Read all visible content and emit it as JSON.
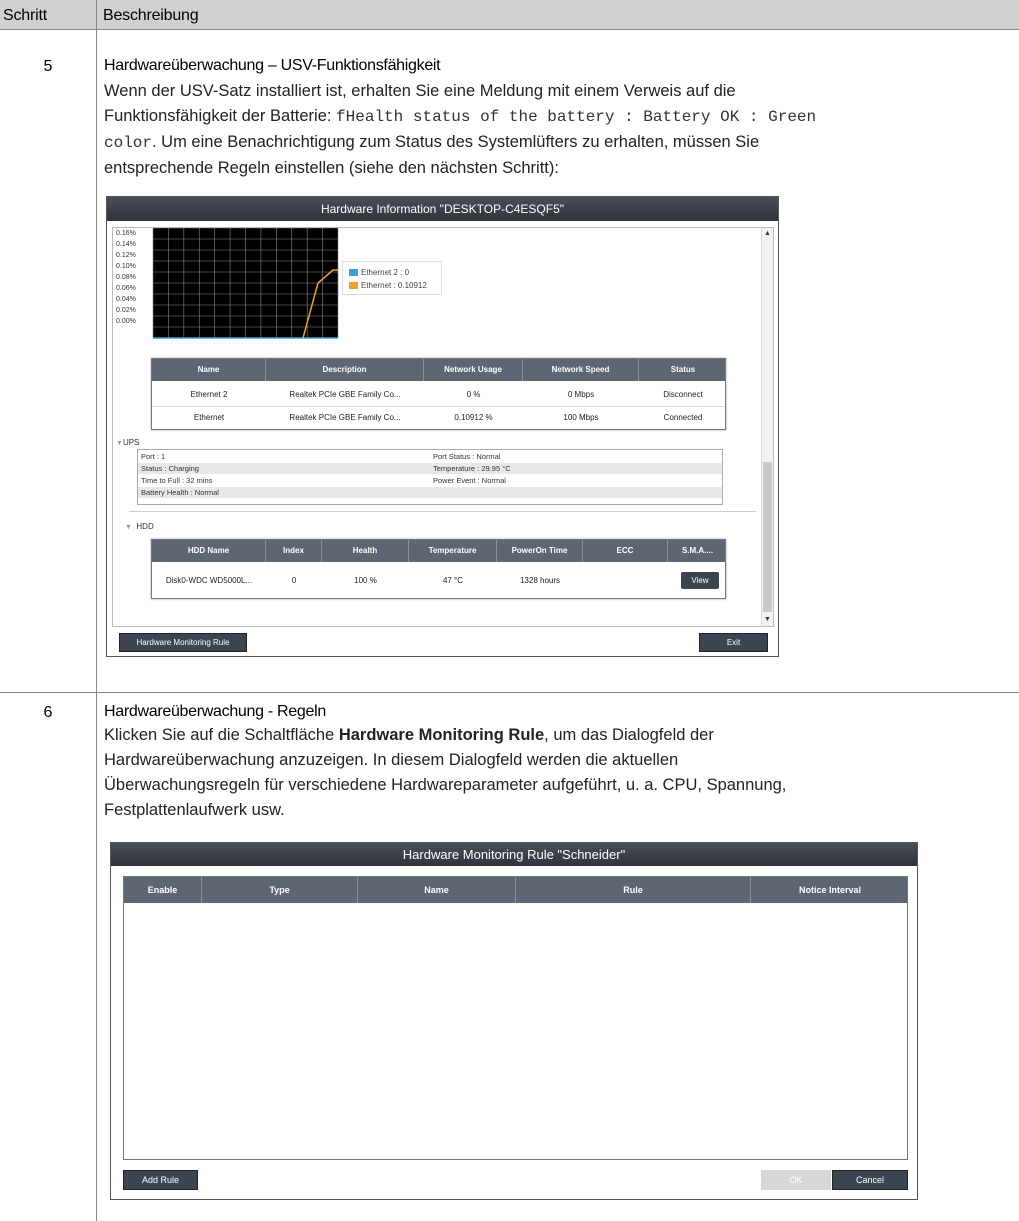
{
  "table": {
    "header_step": "Schritt",
    "header_desc": "Beschreibung"
  },
  "step5": {
    "number": "5",
    "title": "Hardwareüberwachung – USV-Funktionsfähigkeit",
    "body_line1": "Wenn der USV-Satz installiert ist, erhalten Sie eine Meldung mit einem Verweis auf die",
    "body_line2_prefix": "Funktionsfähigkeit der Batterie: ",
    "body_code_1": "fHealth status of the battery : Battery OK : Green",
    "body_code_2": "color",
    "body_line3_suffix": ". Um eine Benachrichtigung zum Status des Systemlüfters zu erhalten, müssen Sie",
    "body_line4": "entsprechende Regeln einstellen (siehe den nächsten Schritt):"
  },
  "win1": {
    "title": "Hardware Information \"DESKTOP-C4ESQF5\"",
    "y_ticks": [
      "0.16%",
      "0.14%",
      "0.12%",
      "0.10%",
      "0.08%",
      "0.06%",
      "0.04%",
      "0.02%",
      "0.00%"
    ],
    "legend": [
      {
        "label": "Ethernet 2 : 0",
        "color": "#3aa0d8"
      },
      {
        "label": "Ethernet : 0.10912",
        "color": "#f0a030"
      }
    ],
    "network_columns": [
      "Name",
      "Description",
      "Network Usage",
      "Network Speed",
      "Status"
    ],
    "network_rows": [
      [
        "Ethernet 2",
        "Realtek PCIe GBE Family Co...",
        "0 %",
        "0 Mbps",
        "Disconnect"
      ],
      [
        "Ethernet",
        "Realtek PCIe GBE Family Co...",
        "0.10912 %",
        "100 Mbps",
        "Connected"
      ]
    ],
    "ups_label": "UPS",
    "ups": {
      "port": "Port : 1",
      "port_status": "Port Status : Normal",
      "status": "Status : Charging",
      "temperature": "Temperature : 29.95 °C",
      "time_to_full": "Time to Full : 32 mins",
      "power_event": "Power Event : Normal",
      "battery_health": "Battery Health : Normal"
    },
    "hdd_label": "HDD",
    "hdd_columns": [
      "HDD Name",
      "Index",
      "Health",
      "Temperature",
      "PowerOn Time",
      "ECC",
      "S.M.A...."
    ],
    "hdd_row": [
      "Disk0-WDC WD5000L...",
      "0",
      "100 %",
      "47 °C",
      "1328 hours",
      ""
    ],
    "view_button": "View",
    "rule_button": "Hardware Monitoring Rule",
    "exit_button": "Exit"
  },
  "step6": {
    "number": "6",
    "title": "Hardwareüberwachung - Regeln",
    "body_line1_prefix": "Klicken Sie auf die Schaltfläche ",
    "body_line1_bold": "Hardware Monitoring Rule",
    "body_line1_suffix": ", um das Dialogfeld der",
    "body_line2": "Hardwareüberwachung anzuzeigen. In diesem Dialogfeld werden die aktuellen",
    "body_line3": "Überwachungsregeln für verschiedene Hardwareparameter aufgeführt, u. a. CPU, Spannung,",
    "body_line4": "Festplattenlaufwerk usw."
  },
  "win2": {
    "title": "Hardware Monitoring Rule \"Schneider\"",
    "columns": [
      "Enable",
      "Type",
      "Name",
      "Rule",
      "Notice Interval"
    ],
    "add_rule": "Add Rule",
    "ok": "OK",
    "cancel": "Cancel"
  }
}
